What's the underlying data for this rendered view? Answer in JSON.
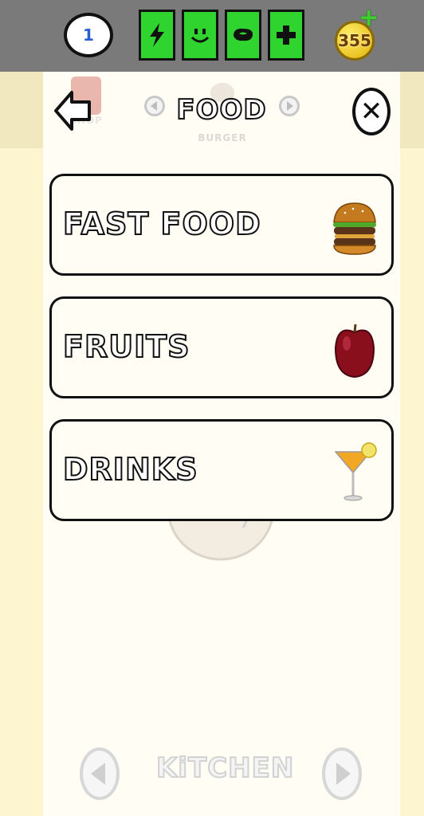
{
  "status_bar": {
    "level": "1",
    "stats": [
      {
        "name": "energy",
        "icon": "lightning-icon"
      },
      {
        "name": "fun",
        "icon": "smiley-icon"
      },
      {
        "name": "hunger",
        "icon": "steak-icon"
      },
      {
        "name": "health",
        "icon": "plus-icon"
      }
    ],
    "coins": "355",
    "stat_color": "#2fd42f"
  },
  "header": {
    "title": "FOOD",
    "prev_room_label": "SHOP",
    "next_room_label": "BURGER"
  },
  "categories": [
    {
      "label": "FAST FOOD",
      "icon": "burger-icon"
    },
    {
      "label": "FRUITS",
      "icon": "apple-icon"
    },
    {
      "label": "DRINKS",
      "icon": "cocktail-icon"
    }
  ],
  "footer": {
    "room_label": "KiTCHEN"
  }
}
